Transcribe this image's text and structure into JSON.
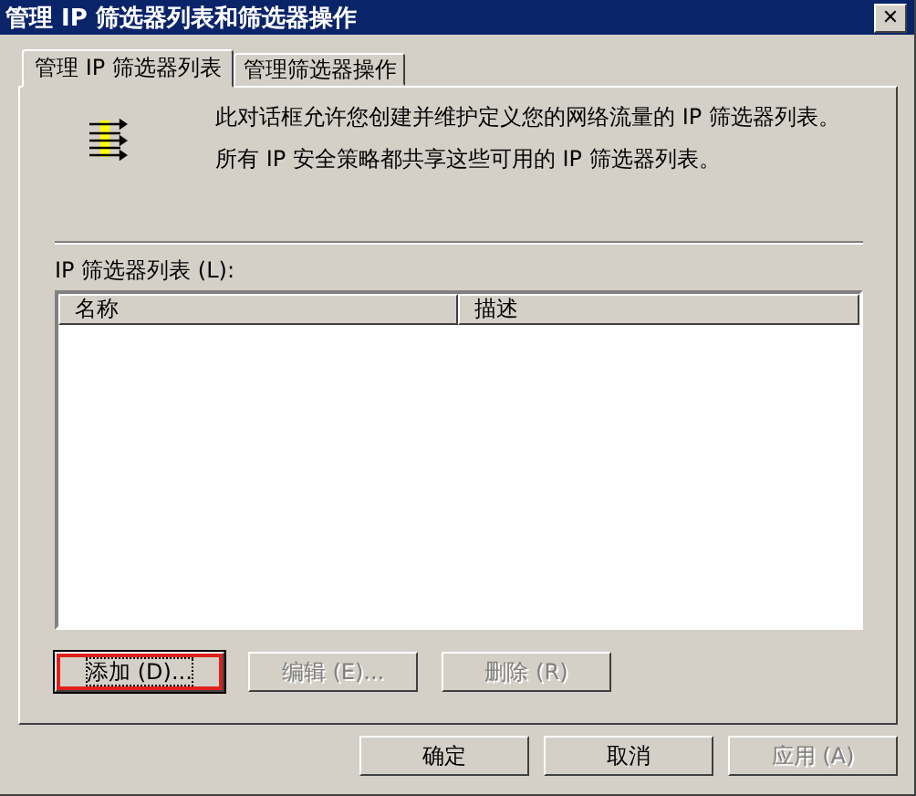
{
  "window": {
    "title": "管理 IP 筛选器列表和筛选器操作",
    "close": "✕"
  },
  "tabs": [
    {
      "label": "管理 IP 筛选器列表",
      "selected": true
    },
    {
      "label": "管理筛选器操作",
      "selected": false
    }
  ],
  "intro": {
    "lines": [
      "此对话框允许您创建并维护定义您的网络流量的 IP 筛选器列表。",
      "所有 IP 安全策略都共享这些可用的 IP 筛选器列表。"
    ]
  },
  "list": {
    "label": "IP 筛选器列表 (L):",
    "columns": [
      "名称",
      "描述"
    ]
  },
  "list_buttons": [
    {
      "label": "添加 (D)...",
      "disabled": false,
      "focused": true,
      "highlighted": true
    },
    {
      "label": "编辑 (E)...",
      "disabled": true,
      "focused": false,
      "highlighted": false
    },
    {
      "label": "删除 (R)",
      "disabled": true,
      "focused": false,
      "highlighted": false
    }
  ],
  "dialog_buttons": [
    {
      "label": "确定",
      "disabled": false
    },
    {
      "label": "取消",
      "disabled": false
    },
    {
      "label": "应用 (A)",
      "disabled": true
    }
  ]
}
